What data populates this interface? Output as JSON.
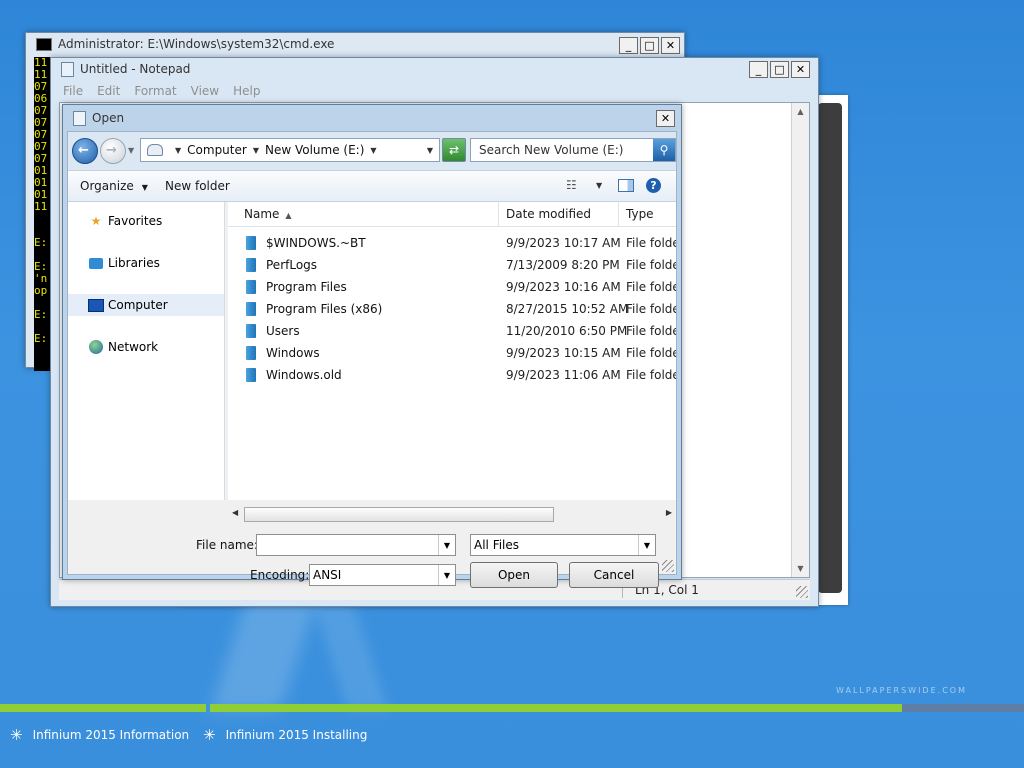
{
  "desktop": {
    "taskbar": {
      "items": [
        {
          "label": "Infinium 2015 Information",
          "progress": 1.0
        },
        {
          "label": "Infinium 2015 Installing",
          "progress": 0.85
        }
      ]
    },
    "watermark": "WALLPAPERSWIDE.COM"
  },
  "cmd_window": {
    "title": "Administrator: E:\\Windows\\system32\\cmd.exe",
    "lines": [
      "11",
      "11",
      "07",
      "06",
      "07",
      "07",
      "07",
      "07",
      "07",
      "01",
      "01",
      "01",
      "11",
      "",
      "",
      "E:",
      "",
      "E:",
      "'n",
      "op",
      "",
      "E:",
      "",
      "E:"
    ]
  },
  "notepad": {
    "title": "Untitled - Notepad",
    "menu": [
      "File",
      "Edit",
      "Format",
      "View",
      "Help"
    ],
    "status_position": "Ln 1, Col 1"
  },
  "open_dialog": {
    "title": "Open",
    "breadcrumb": [
      "Computer",
      "New Volume (E:)"
    ],
    "search_placeholder": "Search New Volume (E:)",
    "toolbar": {
      "organize": "Organize",
      "new_folder": "New folder"
    },
    "nav": [
      "Favorites",
      "Libraries",
      "Computer",
      "Network"
    ],
    "columns": [
      "Name",
      "Date modified",
      "Type"
    ],
    "files": [
      {
        "name": "$WINDOWS.~BT",
        "date": "9/9/2023 10:17 AM",
        "type": "File folder"
      },
      {
        "name": "PerfLogs",
        "date": "7/13/2009 8:20 PM",
        "type": "File folder"
      },
      {
        "name": "Program Files",
        "date": "9/9/2023 10:16 AM",
        "type": "File folder"
      },
      {
        "name": "Program Files (x86)",
        "date": "8/27/2015 10:52 AM",
        "type": "File folder"
      },
      {
        "name": "Users",
        "date": "11/20/2010 6:50 PM",
        "type": "File folder"
      },
      {
        "name": "Windows",
        "date": "9/9/2023 10:15 AM",
        "type": "File folder"
      },
      {
        "name": "Windows.old",
        "date": "9/9/2023 11:06 AM",
        "type": "File folder"
      }
    ],
    "file_name_label": "File name:",
    "file_name_value": "",
    "filter_value": "All Files",
    "encoding_label": "Encoding:",
    "encoding_value": "ANSI",
    "open_button": "Open",
    "cancel_button": "Cancel"
  }
}
